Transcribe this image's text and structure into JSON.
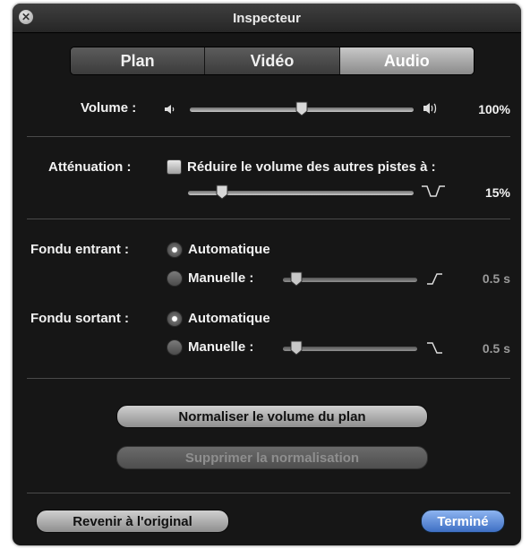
{
  "window": {
    "title": "Inspecteur"
  },
  "tabs": [
    {
      "label": "Plan",
      "active": false
    },
    {
      "label": "Vidéo",
      "active": false
    },
    {
      "label": "Audio",
      "active": true
    }
  ],
  "volume": {
    "label": "Volume :",
    "value_text": "100%",
    "level": 0.5
  },
  "attenuation": {
    "label": "Atténuation :",
    "checkbox_label": "Réduire le volume des autres pistes à :",
    "checked": false,
    "value_text": "15%",
    "level": 0.15
  },
  "fade_in": {
    "label": "Fondu entrant :",
    "auto_label": "Automatique",
    "manual_label": "Manuelle :",
    "selected": "Automatique",
    "value_text": "0.5 s",
    "level": 0.1
  },
  "fade_out": {
    "label": "Fondu sortant :",
    "auto_label": "Automatique",
    "manual_label": "Manuelle :",
    "selected": "Automatique",
    "value_text": "0.5 s",
    "level": 0.1
  },
  "buttons": {
    "normalize": "Normaliser le volume du plan",
    "remove_normalization": "Supprimer la normalisation",
    "revert": "Revenir à l'original",
    "done": "Terminé"
  },
  "colors": {
    "panel": "#161616",
    "accent": "#3e6fc4"
  }
}
